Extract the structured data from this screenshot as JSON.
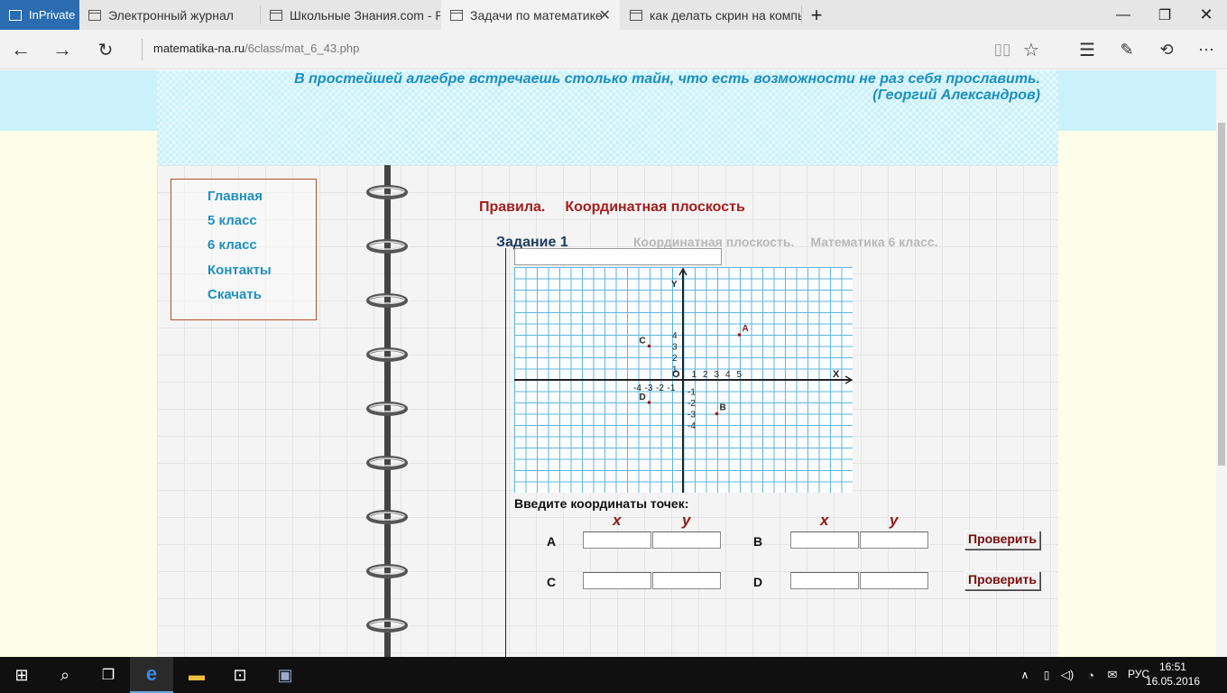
{
  "browser": {
    "private_label": "InPrivate",
    "tabs": [
      {
        "label": "Электронный журнал"
      },
      {
        "label": "Школьные Знания.com - Ре"
      },
      {
        "label": "Задачи по математике"
      },
      {
        "label": "как делать скрин на компь"
      }
    ],
    "new_tab": "+",
    "url_domain": "matematika-na.ru",
    "url_path": "/6class/mat_6_43.php"
  },
  "header": {
    "quote_line1": "В простейшей алгебре встречаешь столько тайн, что есть возможности не раз себя прославить.",
    "quote_line2": "(Георгий Александров)"
  },
  "menu": {
    "items": [
      "Главная",
      "5 класс",
      "6 класс",
      "Контакты",
      "Скачать"
    ]
  },
  "main": {
    "rules_link": "Правила.",
    "topic_link": "Координатная плоскость",
    "task_title": "Задание 1",
    "task_sub1": "Координатная плоскость.",
    "task_sub2": "Математика 6 класс.",
    "prompt": "Введите координаты точек:",
    "col_x": "x",
    "col_y": "y",
    "points": [
      "A",
      "B",
      "C",
      "D"
    ],
    "check_button": "Проверить"
  },
  "chart_data": {
    "type": "scatter",
    "title": "",
    "xlabel": "X",
    "ylabel": "Y",
    "origin_label": "O",
    "x_ticks": [
      "-4",
      "-3",
      "-2",
      "-1",
      "1",
      "2",
      "3",
      "4",
      "5"
    ],
    "y_ticks": [
      "4",
      "3",
      "2",
      "1",
      "-1",
      "-2",
      "-3",
      "-4"
    ],
    "points": [
      {
        "label": "A",
        "x": 5,
        "y": 4
      },
      {
        "label": "B",
        "x": 3,
        "y": -3
      },
      {
        "label": "C",
        "x": -3,
        "y": 3
      },
      {
        "label": "D",
        "x": -3,
        "y": -2
      }
    ],
    "xlim": [
      -15,
      15
    ],
    "ylim": [
      -10,
      10
    ],
    "grid": true,
    "colors": {
      "grid": "#5fb6df",
      "point": "#8b1a1a"
    }
  },
  "taskbar": {
    "lang": "РУС",
    "time": "16:51",
    "date": "16.05.2016"
  }
}
